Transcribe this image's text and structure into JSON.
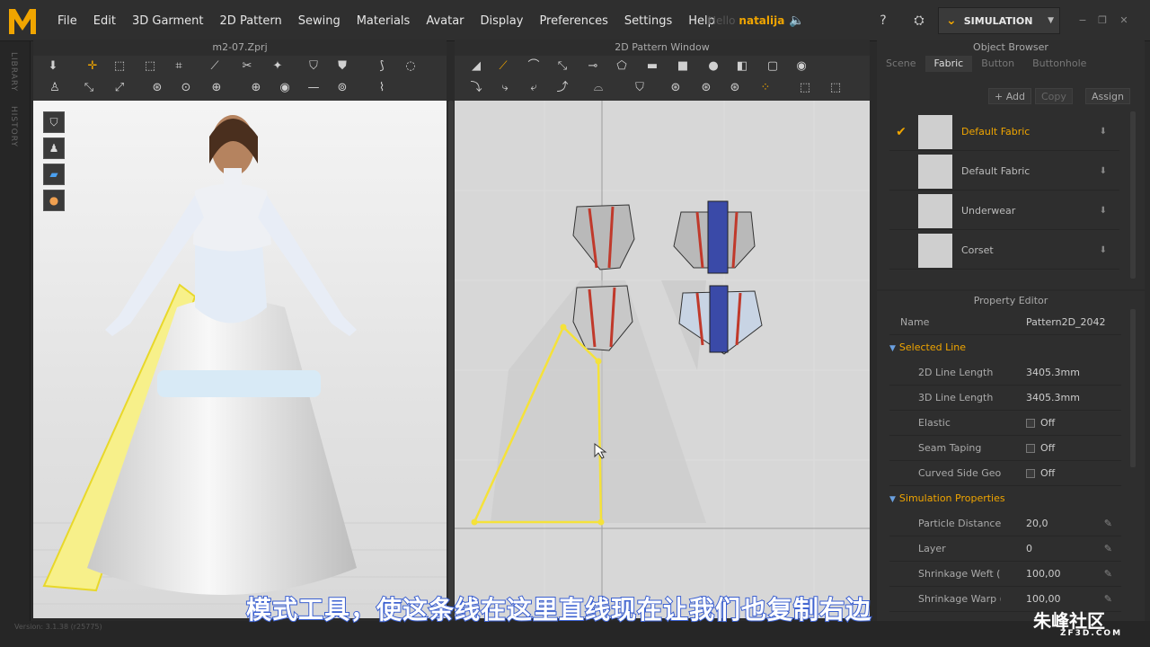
{
  "menu": [
    "File",
    "Edit",
    "3D Garment",
    "2D Pattern",
    "Sewing",
    "Materials",
    "Avatar",
    "Display",
    "Preferences",
    "Settings",
    "Help"
  ],
  "user": {
    "greeting": "Hello",
    "name": "natalija"
  },
  "simulation": {
    "label": "SIMULATION"
  },
  "left_strip": {
    "library": "LIBRARY",
    "history": "HISTORY"
  },
  "window3d": {
    "title": "m2-07.Zprj"
  },
  "window2d": {
    "title": "2D Pattern Window"
  },
  "object_browser": {
    "title": "Object Browser",
    "tabs": [
      "Scene",
      "Fabric",
      "Button",
      "Buttonhole"
    ],
    "active_tab": "Fabric",
    "actions": {
      "add": "+ Add",
      "copy": "Copy",
      "assign": "Assign"
    },
    "fabrics": [
      {
        "name": "Default Fabric",
        "selected": true
      },
      {
        "name": "Default Fabric",
        "selected": false
      },
      {
        "name": "Underwear",
        "selected": false
      },
      {
        "name": "Corset",
        "selected": false
      }
    ]
  },
  "property_editor": {
    "title": "Property Editor",
    "name_label": "Name",
    "name_value": "Pattern2D_2042",
    "selected_line": {
      "label": "Selected Line",
      "rows": [
        {
          "k": "2D Line Length",
          "v": "3405.3mm"
        },
        {
          "k": "3D Line Length",
          "v": "3405.3mm"
        },
        {
          "k": "Elastic",
          "v": "Off"
        },
        {
          "k": "Seam Taping",
          "v": "Off"
        },
        {
          "k": "Curved Side Geome",
          "v": "Off"
        }
      ]
    },
    "simulation_properties": {
      "label": "Simulation Properties",
      "rows": [
        {
          "k": "Particle Distance (m",
          "v": "20,0"
        },
        {
          "k": "Layer",
          "v": "0"
        },
        {
          "k": "Shrinkage Weft (%",
          "v": "100,00"
        },
        {
          "k": "Shrinkage Warp (%",
          "v": "100,00"
        }
      ]
    }
  },
  "version": "Version: 3.1.38 (r25775)",
  "subtitle": "模式工具，使这条线在这里直线现在让我们也复制右边",
  "watermark": {
    "name": "朱峰社区",
    "url": "ZF3D.COM"
  },
  "colors": {
    "accent": "#f0a500",
    "selection": "#f5e23a",
    "bg": "#2e2e2e"
  }
}
